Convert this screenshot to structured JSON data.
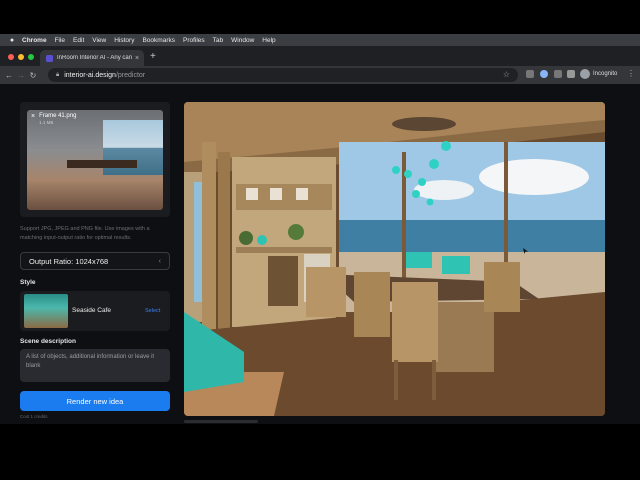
{
  "menubar": {
    "app": "Chrome",
    "items": [
      "File",
      "Edit",
      "View",
      "History",
      "Bookmarks",
      "Profiles",
      "Tab",
      "Window",
      "Help"
    ]
  },
  "browser": {
    "tab_title": "InRoom Interior AI - Any can n",
    "url_host": "interior-ai.design",
    "url_path": "/predictor",
    "profile": "Incognito"
  },
  "upload": {
    "file_name": "Frame 41.png",
    "file_size": "1.1 MB",
    "hint": "Support JPG, JPEG and PNG file. Use images with a matching input-output ratio for optimal results."
  },
  "output_ratio": "Output Ratio: 1024x768",
  "style": {
    "label": "Style",
    "name": "Seaside Cafe",
    "select": "Select"
  },
  "scene": {
    "label": "Scene description",
    "placeholder": "A list of objects, additional information or leave it blank"
  },
  "render_button": "Render new idea",
  "cost": "Cost 1 credits",
  "colors": {
    "accent": "#1b7cf0",
    "teal": "#2fc3b4",
    "background": "#0e0f12"
  }
}
